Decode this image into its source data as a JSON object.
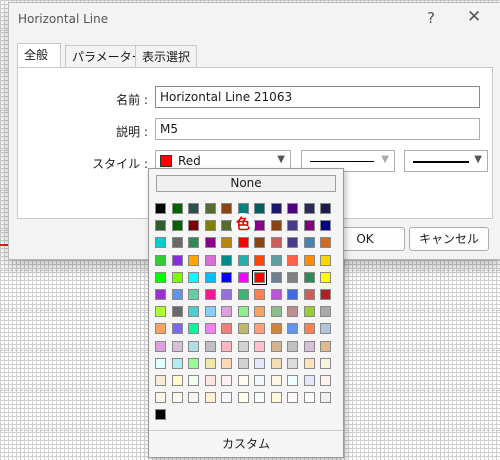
{
  "window": {
    "title": "Horizontal Line",
    "help_glyph": "?",
    "close_glyph": "✕"
  },
  "tabs": [
    {
      "label": "全般"
    },
    {
      "label": "パラメーター"
    },
    {
      "label": "表示選択"
    }
  ],
  "form": {
    "name_label": "名前 :",
    "name_value": "Horizontal Line 21063",
    "description_label": "説明 :",
    "description_value": "M5",
    "style_label": "スタイル :",
    "color_value": "Red",
    "color_hex": "#ff0000"
  },
  "buttons": {
    "ok": "OK",
    "cancel": "キャンセル"
  },
  "color_picker": {
    "none_label": "None",
    "custom_label": "カスタム",
    "tooltip": "色",
    "selected": "#ff0000",
    "rows": [
      [
        "#000000",
        "#006400",
        "#2f4f4f",
        "#556b2f",
        "#8b4513",
        "#008080",
        "#006060",
        "#191970",
        "#4b0082",
        "#2b2b5a",
        "#1c1c50"
      ],
      [
        "#2e5e2e",
        "#006400",
        "#800000",
        "#808000",
        "#556b2f",
        "#008080",
        "#8b008b",
        "#8b4513",
        "#483d8b",
        "#800080",
        "#00008b"
      ],
      [
        "#00ced1",
        "#696969",
        "#2e8b57",
        "#8b008b",
        "#b8860b",
        "#ff0000",
        "#8b4513",
        "#cd5c5c",
        "#483d8b",
        "#4682b4",
        "#d2691e"
      ],
      [
        "#32cd32",
        "#8a2be2",
        "#ffa500",
        "#da70d6",
        "#008b8b",
        "#20b2aa",
        "#ff4500",
        "#5f9ea0",
        "#ff6347",
        "#ff8c00",
        "#ffd700"
      ],
      [
        "#00ff00",
        "#7cfc00",
        "#00ffff",
        "#00bfff",
        "#0000ff",
        "#ff00ff",
        "#ff0000",
        "#708090",
        "#808080",
        "#2e8b57",
        "#ffff00"
      ],
      [
        "#9932cc",
        "#6495ed",
        "#66cdaa",
        "#ff1493",
        "#9370db",
        "#3cb371",
        "#ff7f50",
        "#ba55d3",
        "#4169e1",
        "#cd5c5c",
        "#b22222"
      ],
      [
        "#adff2f",
        "#696969",
        "#48d1cc",
        "#87cefa",
        "#dda0dd",
        "#90ee90",
        "#f4a460",
        "#8fbc8f",
        "#bc8f8f",
        "#9acd32",
        "#a9a9a9"
      ],
      [
        "#f4a460",
        "#7b68ee",
        "#00fa9a",
        "#ee82ee",
        "#f08080",
        "#bdb76b",
        "#ffa07a",
        "#cd853f",
        "#6495ed",
        "#ff7f50",
        "#b0c4de"
      ],
      [
        "#dda0dd",
        "#d8bfd8",
        "#b0e0e6",
        "#c0c0c0",
        "#ffb6c1",
        "#d3d3d3",
        "#ffc0cb",
        "#d2b48c",
        "#c0c0c0",
        "#d8bfd8",
        "#deb887"
      ],
      [
        "#e0ffff",
        "#afeeee",
        "#98fb98",
        "#eee8aa",
        "#ffdab9",
        "#d3d3d3",
        "#e6e6fa",
        "#f5deb3",
        "#dcdcdc",
        "#ffe4b5",
        "#f5f5dc"
      ],
      [
        "#faebd7",
        "#fffacd",
        "#f0fff0",
        "#ffe4e1",
        "#fff0f5",
        "#fffaf0",
        "#f0f8ff",
        "#fdf5e6",
        "#f0ffff",
        "#e6e6fa",
        "#fff5ee"
      ],
      [
        "#fdf5e6",
        "#fffaf0",
        "#f5f5f5",
        "#ffefd5",
        "#f8f8ff",
        "#fffff0",
        "#f5fffa",
        "#fff8dc",
        "#fffafa",
        "#ffffff",
        "#f0f0f0"
      ],
      [
        "#000000"
      ]
    ]
  }
}
